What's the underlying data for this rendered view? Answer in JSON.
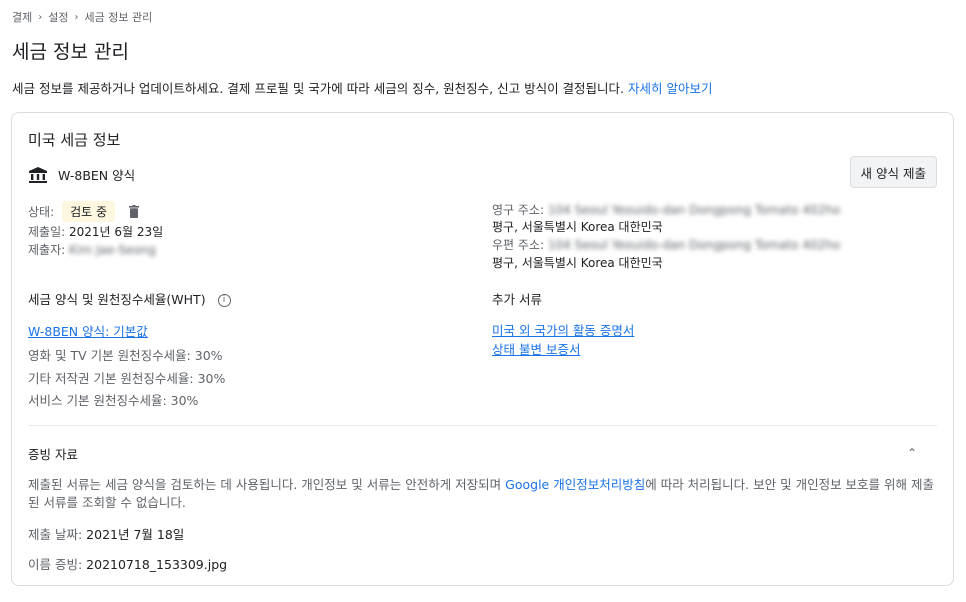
{
  "breadcrumb": [
    "결제",
    "설정",
    "세금 정보 관리"
  ],
  "page_title": "세금 정보 관리",
  "intro": {
    "text": "세금 정보를 제공하거나 업데이트하세요. 결제 프로필 및 국가에 따라 세금의 징수, 원천징수, 신고 방식이 결정됩니다.",
    "link": "자세히 알아보기"
  },
  "card": {
    "title": "미국 세금 정보",
    "form_name": "W-8BEN 양식",
    "submit_button": "새 양식 제출",
    "status_label": "상태:",
    "status_value": "검토 중",
    "submitted_date_label": "제출일:",
    "submitted_date_value": "2021년 6월 23일",
    "submitter_label": "제출자:",
    "submitter_value": "Kim Jae-Seong",
    "permanent_address_label": "영구 주소:",
    "permanent_address_line1": "104 Seoul Yeouido-dan Dongpong Tomato 402ho",
    "permanent_address_line2": "평구, 서울특별시 Korea 대한민국",
    "mailing_address_label": "우편 주소:",
    "mailing_address_line1": "104 Seoul Yeouido-dan Dongpong Tomato 402ho",
    "mailing_address_line2": "평구, 서울특별시 Korea 대한민국",
    "wht_section_label": "세금 양식 및 원천징수세율(WHT)",
    "wht_form_link": "W-8BEN 양식: 기본값",
    "rates": [
      "영화 및 TV 기본 원천징수세율: 30%",
      "기타 저작권 기본 원천징수세율: 30%",
      "서비스 기본 원천징수세율: 30%"
    ],
    "extra_docs_label": "추가 서류",
    "extra_docs": [
      "미국 외 국가의 활동 증명서",
      "상태 불변 보증서"
    ]
  },
  "evidence": {
    "title": "증빙 자료",
    "text_before": "제출된 서류는 세금 양식을 검토하는 데 사용됩니다. 개인정보 및 서류는 안전하게 저장되며",
    "policy_link": "Google 개인정보처리방침",
    "text_after": "에 따라 처리됩니다. 보안 및 개인정보 보호를 위해 제출된 서류를 조회할 수 없습니다.",
    "submit_date_label": "제출 날짜:",
    "submit_date_value": "2021년 7월 18일",
    "name_proof_label": "이름 증빙:",
    "name_proof_value": "20210718_153309.jpg"
  },
  "colors": {
    "accent": "#1a73e8",
    "badge_bg": "#fef7e0",
    "border": "#dadce0"
  },
  "icons": {
    "breadcrumb_sep": "chevron-right-icon",
    "form": "bank-icon",
    "delete": "trash-icon",
    "info": "info-icon",
    "collapse": "chevron-up-icon"
  }
}
